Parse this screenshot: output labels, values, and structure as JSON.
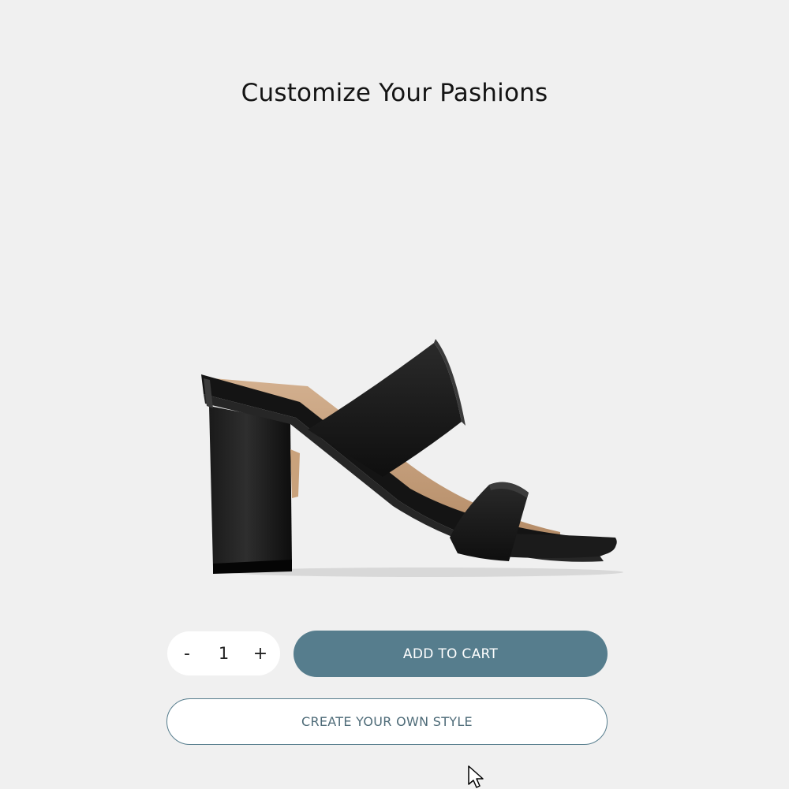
{
  "page": {
    "title": "Customize Your Pashions"
  },
  "product": {
    "image_icon": "sandal-heel-image"
  },
  "quantity": {
    "decrement_label": "-",
    "value": "1",
    "increment_label": "+"
  },
  "actions": {
    "add_to_cart_label": "ADD TO CART",
    "create_style_label": "CREATE YOUR OWN STYLE"
  },
  "colors": {
    "background": "#f0f0f0",
    "accent": "#567d8d",
    "button_text_light": "#ffffff",
    "outline_text": "#4e6b78"
  }
}
